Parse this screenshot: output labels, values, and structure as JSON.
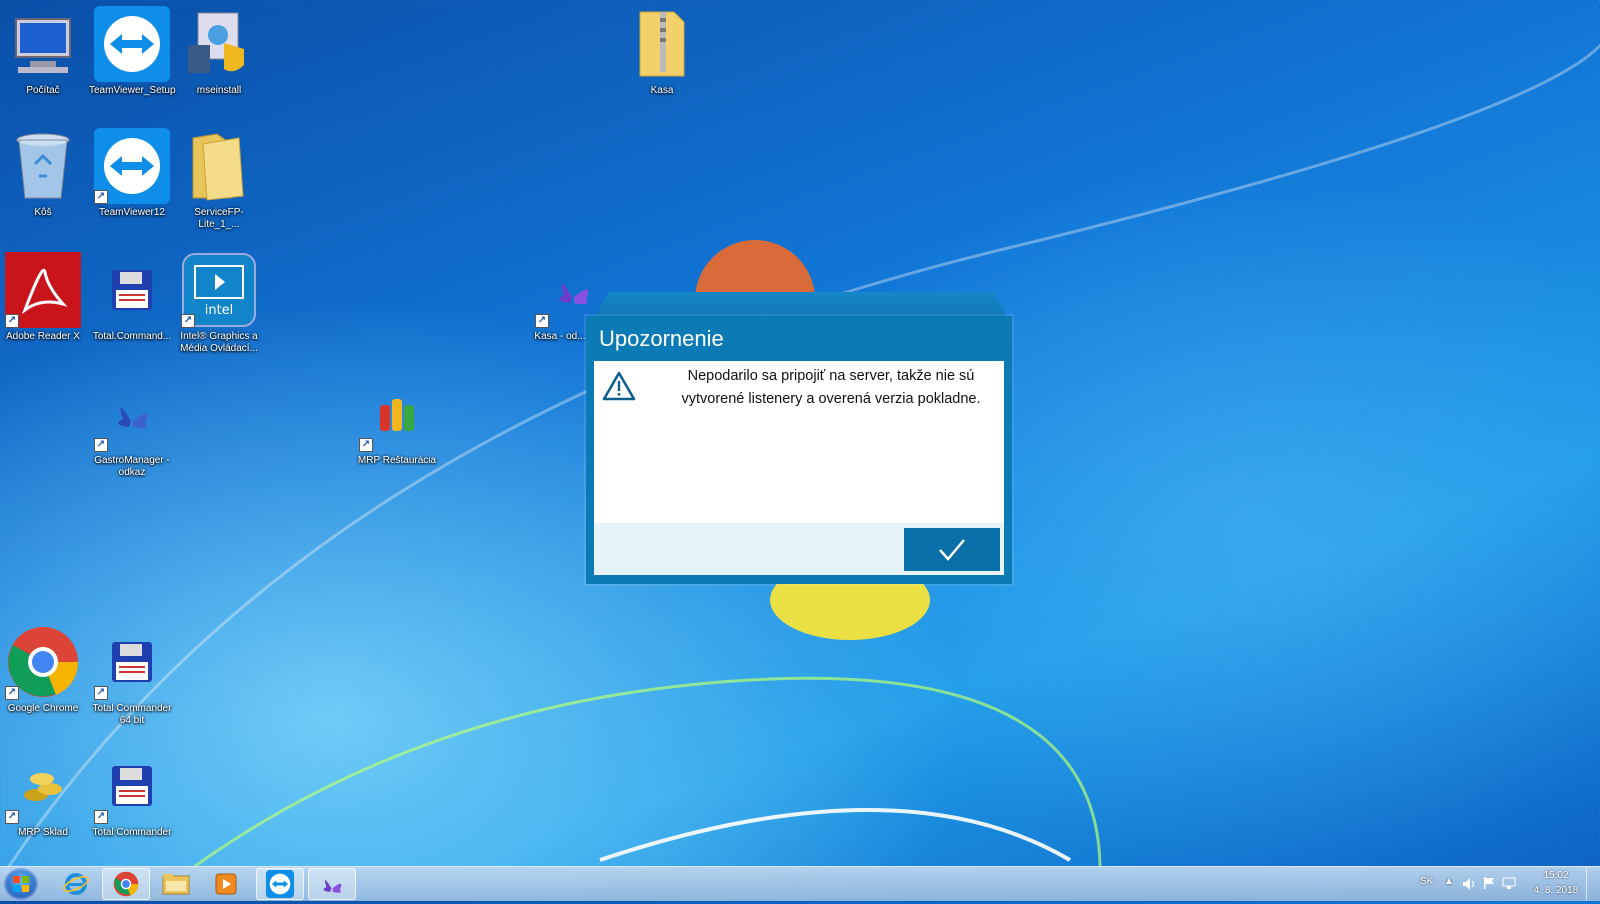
{
  "desktop_icons": [
    {
      "label": "Počítač"
    },
    {
      "label": "TeamViewer_Setup"
    },
    {
      "label": "mseinstall"
    },
    {
      "label": "Kasa"
    },
    {
      "label": "Kôš"
    },
    {
      "label": "TeamViewer12"
    },
    {
      "label": "ServiceFP-Lite_1_..."
    },
    {
      "label": "Adobe Reader X"
    },
    {
      "label": "Total.Command..."
    },
    {
      "label": "Intel® Graphics a Média Ovládací..."
    },
    {
      "label": "Kasa - od..."
    },
    {
      "label": "GastroManager - odkaz"
    },
    {
      "label": "MRP Reštaurácia"
    },
    {
      "label": "Google Chrome"
    },
    {
      "label": "Total Commander 64 bit"
    },
    {
      "label": "MRP Sklad"
    },
    {
      "label": "Total Commander"
    }
  ],
  "dialog": {
    "title": "Upozornenie",
    "message": "Nepodarilo sa pripojiť na server, takže nie sú vytvorené listenery a overená verzia pokladne.",
    "ok_icon": "checkmark-icon"
  },
  "taskbar": {
    "items": [
      "start-orb-icon",
      "internet-explorer-icon",
      "chrome-icon",
      "explorer-folder-icon",
      "media-player-icon",
      "teamviewer-icon",
      "gastromanager-icon"
    ],
    "language": "SK",
    "time": "15:02",
    "date": "4. 8. 2018"
  },
  "colors": {
    "dialog_frame": "#0c7ab4",
    "ok_button": "#0a6fa8",
    "footer_bg": "#e6f3f9"
  }
}
